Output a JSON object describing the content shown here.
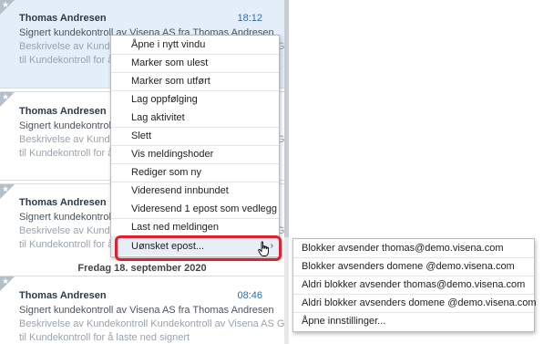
{
  "messages": [
    {
      "sender": "Thomas Andresen",
      "time": "18:12",
      "subject": "Signert kundekontroll av Visena AS fra Thomas Andresen",
      "desc1": "Beskrivelse av Kundekontroll Kundekontroll av Visena AS Gå",
      "desc2": "til Kundekontroll for å laste ned signert"
    },
    {
      "sender": "Thomas Andresen",
      "subject": "Signert kundekontroll av Visena AS fra Thomas Andresen",
      "desc1": "Beskrivelse av Kundekontroll Kundekontroll av Visena AS Gå",
      "desc2": "til Kundekontroll for å laste ned signert"
    },
    {
      "sender": "Thomas Andresen",
      "subject": "Signert kundekontroll av Visena AS fra Thomas Andresen",
      "desc1": "Beskrivelse av Kundekontroll Kundekontroll av Visena AS Gå",
      "desc2": "til Kundekontroll for å laste ned signert"
    },
    {
      "sender": "Thomas Andresen",
      "time": "08:46",
      "subject": "Signert kundekontroll av Visena AS fra Thomas Andresen",
      "desc1": "Beskrivelse av Kundekontroll Kundekontroll av Visena AS Gå",
      "desc2": "til Kundekontroll for å laste ned signert"
    }
  ],
  "date_divider": "Fredag 18. september 2020",
  "context_menu": {
    "items": [
      "Åpne i nytt vindu",
      "Marker som ulest",
      "Marker som utført",
      "Lag oppfølging",
      "Lag aktivitet",
      "Slett",
      "Vis meldingshoder",
      "Rediger som ny",
      "Videresend innbundet",
      "Videresend 1 epost som vedlegg",
      "Last ned meldingen",
      "Uønsket epost..."
    ]
  },
  "submenu": {
    "items": [
      "Blokker avsender thomas@demo.visena.com",
      "Blokker avsenders domene @demo.visena.com",
      "Aldri blokker avsender thomas@demo.visena.com",
      "Aldri blokker avsenders domene @demo.visena.com",
      "Åpne innstillinger..."
    ]
  },
  "colors": {
    "accent_time": "#2a6fb5",
    "selected_bg": "#e4eef8",
    "highlight_border": "#e0202e"
  }
}
